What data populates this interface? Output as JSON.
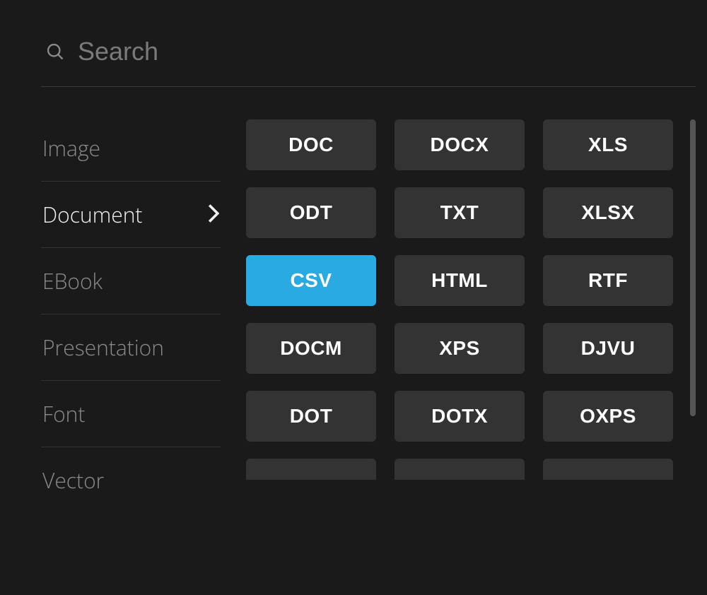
{
  "search": {
    "placeholder": "Search",
    "value": ""
  },
  "sidebar": {
    "items": [
      {
        "label": "Image",
        "active": false
      },
      {
        "label": "Document",
        "active": true
      },
      {
        "label": "EBook",
        "active": false
      },
      {
        "label": "Presentation",
        "active": false
      },
      {
        "label": "Font",
        "active": false
      },
      {
        "label": "Vector",
        "active": false
      }
    ]
  },
  "formats": [
    {
      "label": "DOC",
      "selected": false
    },
    {
      "label": "DOCX",
      "selected": false
    },
    {
      "label": "XLS",
      "selected": false
    },
    {
      "label": "ODT",
      "selected": false
    },
    {
      "label": "TXT",
      "selected": false
    },
    {
      "label": "XLSX",
      "selected": false
    },
    {
      "label": "CSV",
      "selected": true
    },
    {
      "label": "HTML",
      "selected": false
    },
    {
      "label": "RTF",
      "selected": false
    },
    {
      "label": "DOCM",
      "selected": false
    },
    {
      "label": "XPS",
      "selected": false
    },
    {
      "label": "DJVU",
      "selected": false
    },
    {
      "label": "DOT",
      "selected": false
    },
    {
      "label": "DOTX",
      "selected": false
    },
    {
      "label": "OXPS",
      "selected": false
    }
  ]
}
